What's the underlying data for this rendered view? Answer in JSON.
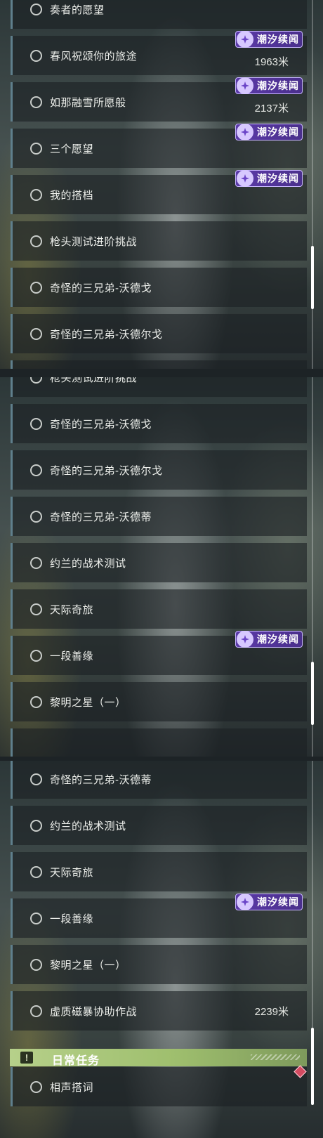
{
  "badge_text": "潮汐续闻",
  "panel1": {
    "items": [
      {
        "label": "奏者的愿望",
        "badge": false,
        "distance": ""
      },
      {
        "label": "春风祝颂你的旅途",
        "badge": true,
        "distance": "1963米"
      },
      {
        "label": "如那融雪所愿般",
        "badge": true,
        "distance": "2137米"
      },
      {
        "label": "三个愿望",
        "badge": true,
        "distance": ""
      },
      {
        "label": "我的搭档",
        "badge": true,
        "distance": ""
      },
      {
        "label": "枪头测试进阶挑战",
        "badge": false,
        "distance": ""
      },
      {
        "label": "奇怪的三兄弟-沃德戈",
        "badge": false,
        "distance": ""
      },
      {
        "label": "奇怪的三兄弟-沃德尔戈",
        "badge": false,
        "distance": ""
      }
    ]
  },
  "panel2": {
    "items": [
      {
        "label": "枪头测试进阶挑战",
        "badge": false,
        "distance": ""
      },
      {
        "label": "奇怪的三兄弟-沃德戈",
        "badge": false,
        "distance": ""
      },
      {
        "label": "奇怪的三兄弟-沃德尔戈",
        "badge": false,
        "distance": ""
      },
      {
        "label": "奇怪的三兄弟-沃德蒂",
        "badge": false,
        "distance": ""
      },
      {
        "label": "约兰的战术测试",
        "badge": false,
        "distance": ""
      },
      {
        "label": "天际奇旅",
        "badge": false,
        "distance": ""
      },
      {
        "label": "一段善缘",
        "badge": true,
        "distance": ""
      },
      {
        "label": "黎明之星（一）",
        "badge": false,
        "distance": ""
      }
    ]
  },
  "panel3": {
    "items": [
      {
        "label": "奇怪的三兄弟-沃德蒂",
        "badge": false,
        "distance": ""
      },
      {
        "label": "约兰的战术测试",
        "badge": false,
        "distance": ""
      },
      {
        "label": "天际奇旅",
        "badge": false,
        "distance": ""
      },
      {
        "label": "一段善缘",
        "badge": true,
        "distance": ""
      },
      {
        "label": "黎明之星（一）",
        "badge": false,
        "distance": ""
      },
      {
        "label": "虚质磁暴协助作战",
        "badge": false,
        "distance": "2239米"
      }
    ],
    "section": {
      "title": "日常任务",
      "icon": "exclamation-icon",
      "icon_glyph": "!"
    },
    "daily_items": [
      {
        "label": "相声搭词",
        "badge": false,
        "distance": ""
      }
    ]
  },
  "colors": {
    "badge_purple": "#5b3aa8",
    "section_green": "#b6d08a",
    "item_left_border": "#5f7f8c",
    "marker_red": "#d44b61"
  }
}
